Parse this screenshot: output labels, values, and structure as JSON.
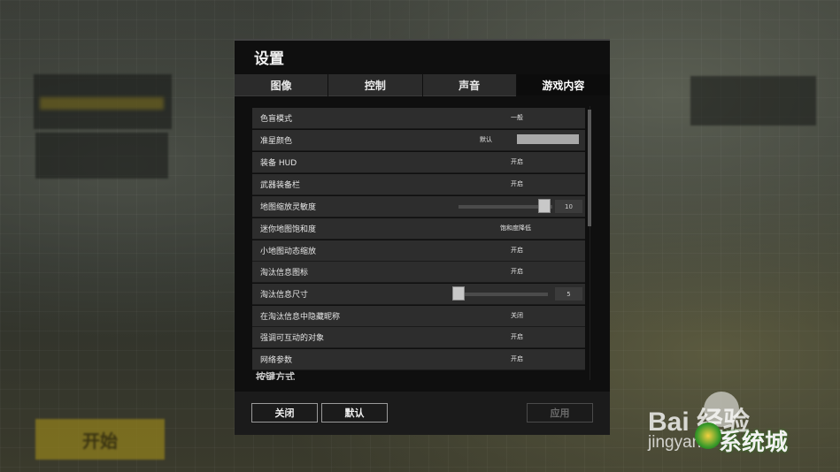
{
  "background": {
    "start_label": "开始"
  },
  "dialog": {
    "title": "设置",
    "tabs": [
      {
        "label": "图像",
        "active": false
      },
      {
        "label": "控制",
        "active": false
      },
      {
        "label": "声音",
        "active": false
      },
      {
        "label": "游戏内容",
        "active": true
      }
    ],
    "settings": [
      {
        "label": "色盲模式",
        "value": "一般"
      },
      {
        "label": "准星颜色",
        "value": "默认",
        "swatch_color": "#a9a9a9"
      },
      {
        "label": "装备 HUD",
        "value": "开启"
      },
      {
        "label": "武器装备栏",
        "value": "开启"
      },
      {
        "label": "地图缩放灵敏度",
        "slider_value": "10",
        "slider_fraction": 0.98
      },
      {
        "label": "迷你地图饱和度",
        "value": "饱和度降低"
      },
      {
        "label": "小地图动态缩放",
        "value": "开启"
      },
      {
        "label": "淘汰信息图标",
        "value": "开启"
      },
      {
        "label": "淘汰信息尺寸",
        "slider_value": "5",
        "slider_fraction": 0.0
      },
      {
        "label": "在淘汰信息中隐藏昵称",
        "value": "关闭"
      },
      {
        "label": "强调可互动的对象",
        "value": "开启"
      },
      {
        "label": "网络参数",
        "value": "开启"
      }
    ],
    "next_section_peek": "按键方式",
    "buttons": {
      "close": "关闭",
      "default": "默认",
      "apply": "应用"
    }
  },
  "watermark": {
    "brand": "Bai 经验",
    "url": "jingyan",
    "site": "系统城"
  },
  "colors": {
    "dialog_bg": "#0f0f0f",
    "row_bg": "#2d2d2d",
    "tab_bg": "#2b2b2b",
    "accent_start": "#8a7a1e"
  }
}
